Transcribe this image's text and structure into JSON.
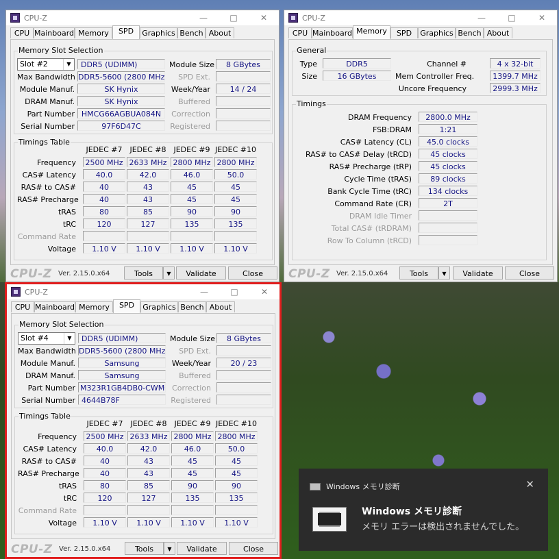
{
  "window_title": "CPU-Z",
  "tabs": [
    "CPU",
    "Mainboard",
    "Memory",
    "SPD",
    "Graphics",
    "Bench",
    "About"
  ],
  "spd_labels": {
    "section_slot": "Memory Slot Selection",
    "module_size": "Module Size",
    "max_bandwidth": "Max Bandwidth",
    "spd_ext": "SPD Ext.",
    "module_manuf": "Module Manuf.",
    "week_year": "Week/Year",
    "dram_manuf": "DRAM Manuf.",
    "buffered": "Buffered",
    "part_number": "Part Number",
    "correction": "Correction",
    "serial_number": "Serial Number",
    "registered": "Registered",
    "section_timings": "Timings Table",
    "row_labels": [
      "Frequency",
      "CAS# Latency",
      "RAS# to CAS#",
      "RAS# Precharge",
      "tRAS",
      "tRC",
      "Command Rate",
      "Voltage"
    ],
    "col_headers": [
      "JEDEC #7",
      "JEDEC #8",
      "JEDEC #9",
      "JEDEC #10"
    ]
  },
  "spd_top": {
    "slot": "Slot #2",
    "memory_type": "DDR5 (UDIMM)",
    "module_size": "8 GBytes",
    "max_bandwidth": "DDR5-5600 (2800 MHz)",
    "module_manuf": "SK Hynix",
    "week_year": "14 / 24",
    "dram_manuf": "SK Hynix",
    "part_number": "HMCG66AGBUA084N",
    "serial_number": "97F6D47C"
  },
  "spd_bottom": {
    "slot": "Slot #4",
    "memory_type": "DDR5 (UDIMM)",
    "module_size": "8 GBytes",
    "max_bandwidth": "DDR5-5600 (2800 MHz)",
    "module_manuf": "Samsung",
    "week_year": "20 / 23",
    "dram_manuf": "Samsung",
    "part_number": "M323R1GB4DB0-CWMOL",
    "serial_number": "4644B78F"
  },
  "timings": {
    "frequency": [
      "2500 MHz",
      "2633 MHz",
      "2800 MHz",
      "2800 MHz"
    ],
    "cas": [
      "40.0",
      "42.0",
      "46.0",
      "50.0"
    ],
    "ras_cas": [
      "40",
      "43",
      "45",
      "45"
    ],
    "ras_pre": [
      "40",
      "43",
      "45",
      "45"
    ],
    "tras": [
      "80",
      "85",
      "90",
      "90"
    ],
    "trc": [
      "120",
      "127",
      "135",
      "135"
    ],
    "voltage": [
      "1.10 V",
      "1.10 V",
      "1.10 V",
      "1.10 V"
    ]
  },
  "memory": {
    "general": "General",
    "type_label": "Type",
    "type": "DDR5",
    "size_label": "Size",
    "size": "16 GBytes",
    "channel_label": "Channel #",
    "channel": "4 x 32-bit",
    "mem_ctrl_label": "Mem Controller Freq.",
    "mem_ctrl": "1399.7 MHz",
    "uncore_label": "Uncore Frequency",
    "uncore": "2999.3 MHz",
    "timings_title": "Timings",
    "labels": [
      "DRAM Frequency",
      "FSB:DRAM",
      "CAS# Latency (CL)",
      "RAS# to CAS# Delay (tRCD)",
      "RAS# Precharge (tRP)",
      "Cycle Time (tRAS)",
      "Bank Cycle Time (tRC)",
      "Command Rate (CR)",
      "DRAM Idle Timer",
      "Total CAS# (tRDRAM)",
      "Row To Column (tRCD)"
    ],
    "values": [
      "2800.0 MHz",
      "1:21",
      "45.0 clocks",
      "45 clocks",
      "45 clocks",
      "89 clocks",
      "134 clocks",
      "2T"
    ]
  },
  "footer": {
    "brand": "CPU-Z",
    "version": "Ver. 2.15.0.x64",
    "tools": "Tools",
    "validate": "Validate",
    "close": "Close"
  },
  "toast": {
    "app": "Windows メモリ診断",
    "title": "Windows メモリ診断",
    "message": "メモリ エラーは検出されませんでした。"
  }
}
